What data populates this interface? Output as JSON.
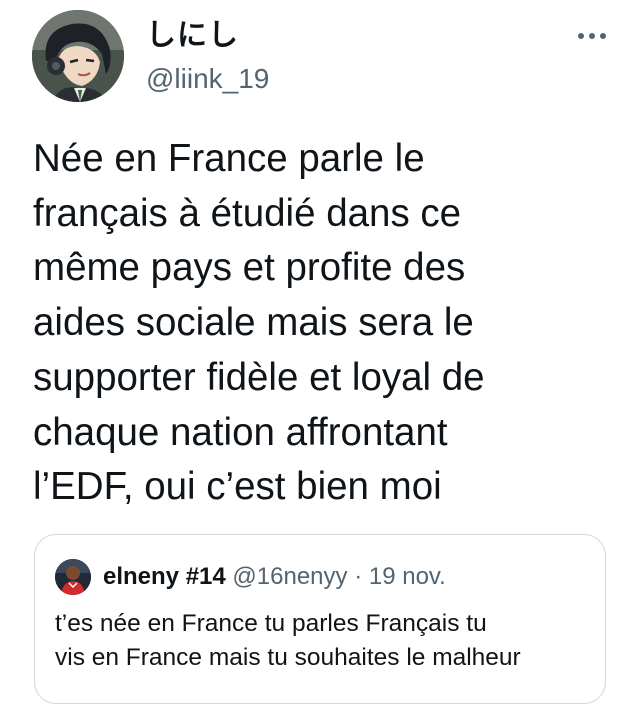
{
  "tweet": {
    "author": {
      "display_name": "しにし",
      "handle": "@liink_19",
      "avatar_icon": "anime-character-avatar"
    },
    "more_icon": "more-horizontal-icon",
    "text": "Née en France parle le\nfrançais à étudié dans ce\nmême pays et profite des\naides sociale mais sera le\nsupporter fidèle et loyal de\nchaque nation affrontant\nl’EDF, oui c’est bien moi"
  },
  "quoted_tweet": {
    "display_name": "elneny #14",
    "handle": "@16nenyy",
    "separator": "·",
    "date": "19 nov.",
    "avatar_icon": "footballer-avatar",
    "text": "t’es née en France tu parles Français tu\nvis en France mais tu souhaites le malheur"
  },
  "colors": {
    "text_primary": "#0f1419",
    "text_secondary": "#536471",
    "border": "#cfd9de",
    "background": "#ffffff"
  }
}
